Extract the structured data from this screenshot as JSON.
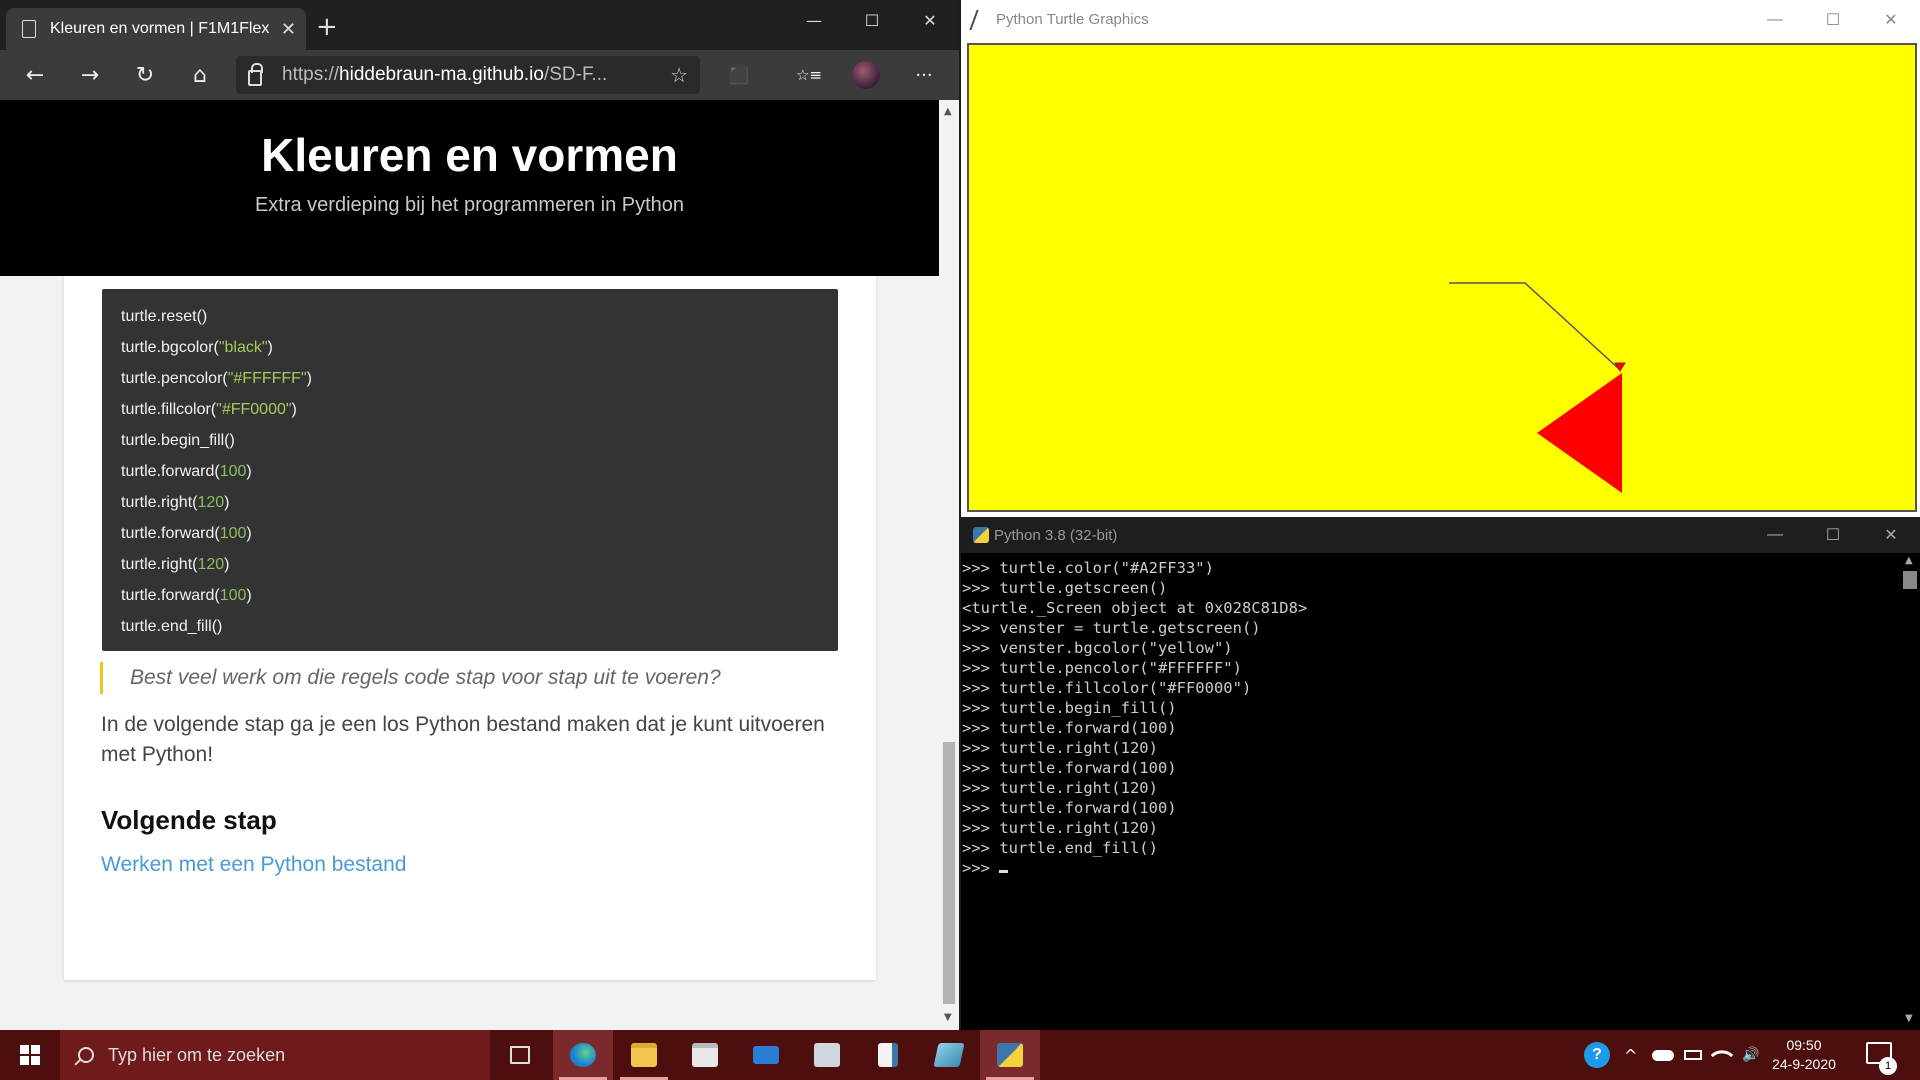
{
  "browser": {
    "tab_title": "Kleuren en vormen | F1M1Flex -",
    "tab_close": "✕",
    "new_tab": "+",
    "url_scheme": "https://",
    "url_host": "hiddebraun-ma.github.io",
    "url_path": "/SD-F...",
    "minimize": "—",
    "maximize": "☐",
    "close": "✕",
    "nav": {
      "back": "←",
      "forward": "→",
      "refresh": "↻",
      "home": "⌂",
      "favorite": "☆",
      "collections": "☆≡",
      "more": "···",
      "extension": "⬛"
    }
  },
  "page": {
    "title": "Kleuren en vormen",
    "subtitle": "Extra verdieping bij het programmeren in Python",
    "code_lines": [
      {
        "pre": "turtle.reset()",
        "arg": "",
        "post": "",
        "kind": "none"
      },
      {
        "pre": "turtle.bgcolor(",
        "arg": "\"black\"",
        "post": ")",
        "kind": "str"
      },
      {
        "pre": "turtle.pencolor(",
        "arg": "\"#FFFFFF\"",
        "post": ")",
        "kind": "str"
      },
      {
        "pre": "turtle.fillcolor(",
        "arg": "\"#FF0000\"",
        "post": ")",
        "kind": "str"
      },
      {
        "pre": "turtle.begin_fill()",
        "arg": "",
        "post": "",
        "kind": "none"
      },
      {
        "pre": "turtle.forward(",
        "arg": "100",
        "post": ")",
        "kind": "num"
      },
      {
        "pre": "turtle.right(",
        "arg": "120",
        "post": ")",
        "kind": "num"
      },
      {
        "pre": "turtle.forward(",
        "arg": "100",
        "post": ")",
        "kind": "num"
      },
      {
        "pre": "turtle.right(",
        "arg": "120",
        "post": ")",
        "kind": "num"
      },
      {
        "pre": "turtle.forward(",
        "arg": "100",
        "post": ")",
        "kind": "num"
      },
      {
        "pre": "turtle.end_fill()",
        "arg": "",
        "post": "",
        "kind": "none"
      }
    ],
    "quote": "Best veel werk om die regels code stap voor stap uit te voeren?",
    "paragraph": "In de volgende stap ga je een los Python bestand maken dat je kunt uitvoeren met Python!",
    "next_heading": "Volgende stap",
    "next_link": "Werken met een Python bestand"
  },
  "turtle_window": {
    "title": "Python Turtle Graphics",
    "bg_color": "#ffff00",
    "fill_color": "#ff0000",
    "minimize": "—",
    "maximize": "☐",
    "close": "✕"
  },
  "shell": {
    "title": "Python 3.8 (32-bit)",
    "lines": [
      ">>> turtle.color(\"#A2FF33\")",
      ">>> turtle.getscreen()",
      "<turtle._Screen object at 0x028C81D8>",
      ">>> venster = turtle.getscreen()",
      ">>> venster.bgcolor(\"yellow\")",
      ">>> turtle.pencolor(\"#FFFFFF\")",
      ">>> turtle.fillcolor(\"#FF0000\")",
      ">>> turtle.begin_fill()",
      ">>> turtle.forward(100)",
      ">>> turtle.right(120)",
      ">>> turtle.forward(100)",
      ">>> turtle.right(120)",
      ">>> turtle.forward(100)",
      ">>> turtle.right(120)",
      ">>> turtle.end_fill()"
    ],
    "prompt": ">>> ",
    "minimize": "—",
    "maximize": "☐",
    "close": "✕"
  },
  "taskbar": {
    "search_placeholder": "Typ hier om te zoeken",
    "time": "09:50",
    "date": "24-9-2020",
    "notifications": "1",
    "help": "?",
    "tray_chevron": "^",
    "volume": "🔊"
  }
}
